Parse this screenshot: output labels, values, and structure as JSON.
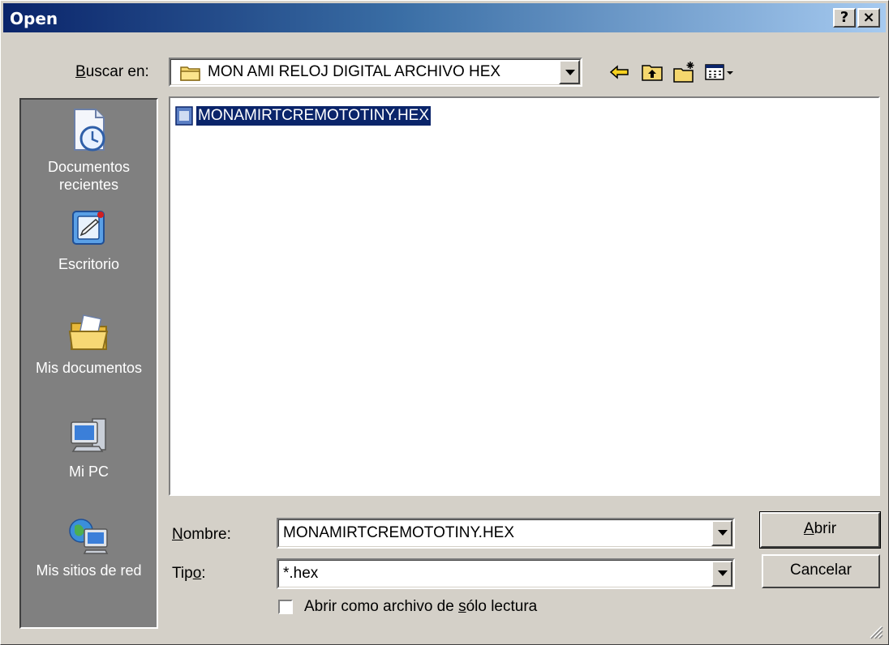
{
  "titlebar": {
    "title": "Open",
    "help_label": "?",
    "close_label": "×"
  },
  "lookin": {
    "label_prefix": "",
    "label_accel": "B",
    "label_rest": "uscar en:",
    "folder": "MON AMI RELOJ DIGITAL ARCHIVO HEX"
  },
  "toolbar": {
    "icons": [
      "back-icon",
      "up-folder-icon",
      "new-folder-icon",
      "view-menu-icon"
    ]
  },
  "places": [
    {
      "line1": "Documentos",
      "line2": "recientes",
      "icon": "recent-documents-icon"
    },
    {
      "line1": "Escritorio",
      "line2": "",
      "icon": "desktop-icon"
    },
    {
      "line1": "Mis documentos",
      "line2": "",
      "icon": "my-documents-icon"
    },
    {
      "line1": "Mi PC",
      "line2": "",
      "icon": "my-computer-icon"
    },
    {
      "line1": "Mis sitios de red",
      "line2": "",
      "icon": "network-places-icon"
    }
  ],
  "files": [
    {
      "name": "MONAMIRTCREMOTOTINY.HEX",
      "icon": "hex-file-icon",
      "selected": true
    }
  ],
  "filename": {
    "label_accel": "N",
    "label_rest": "ombre:",
    "value": "MONAMIRTCREMOTOTINY.HEX"
  },
  "filetype": {
    "label_pre": "Tip",
    "label_accel": "o",
    "label_post": ":",
    "value": "*.hex"
  },
  "readonly": {
    "label_pre": "Abrir como archivo de ",
    "label_accel": "s",
    "label_post": "ólo lectura",
    "checked": false
  },
  "buttons": {
    "open_accel": "A",
    "open_rest": "brir",
    "cancel": "Cancelar"
  }
}
